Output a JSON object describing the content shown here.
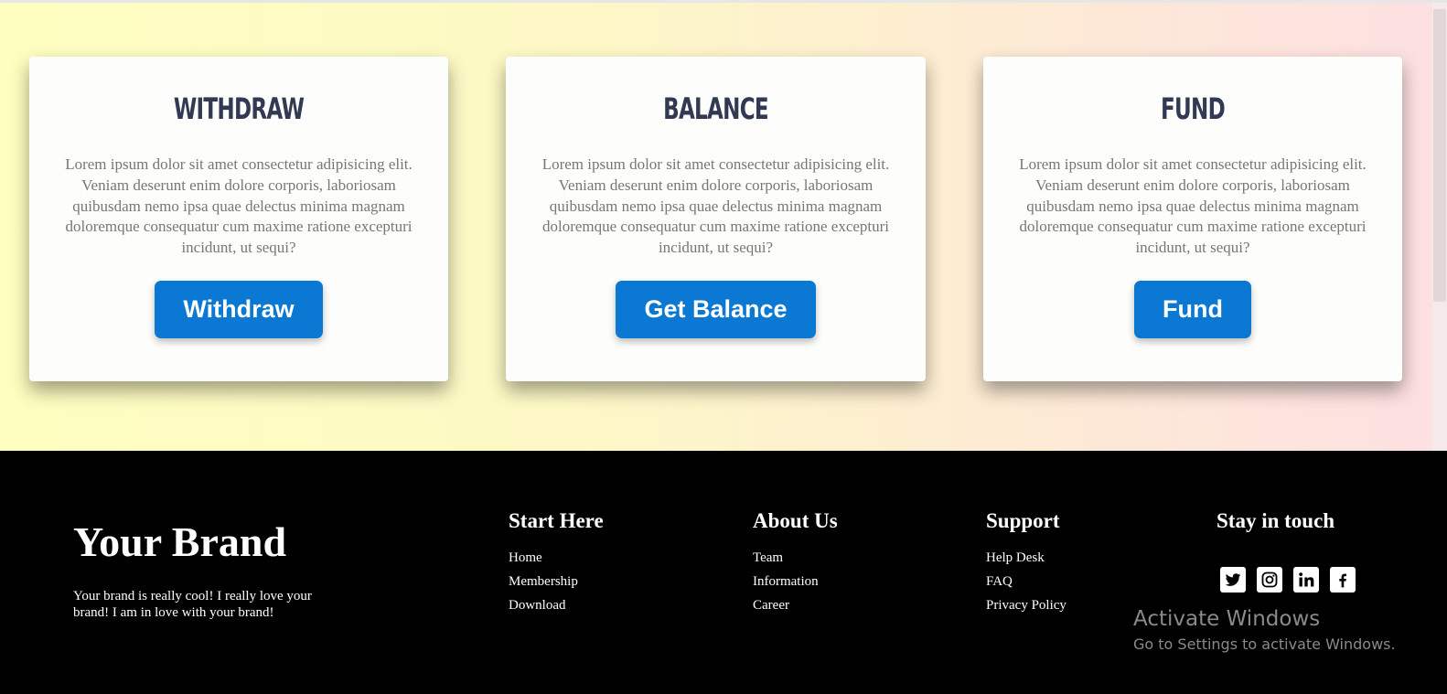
{
  "cards": [
    {
      "title": "WITHDRAW",
      "text": "Lorem ipsum dolor sit amet consectetur adipisicing elit. Veniam deserunt enim dolore corporis, laboriosam quibusdam nemo ipsa quae delectus minima magnam doloremque consequatur cum maxime ratione excepturi incidunt, ut sequi?",
      "button": "Withdraw"
    },
    {
      "title": "BALANCE",
      "text": "Lorem ipsum dolor sit amet consectetur adipisicing elit. Veniam deserunt enim dolore corporis, laboriosam quibusdam nemo ipsa quae delectus minima magnam doloremque consequatur cum maxime ratione excepturi incidunt, ut sequi?",
      "button": "Get Balance"
    },
    {
      "title": "FUND",
      "text": "Lorem ipsum dolor sit amet consectetur adipisicing elit. Veniam deserunt enim dolore corporis, laboriosam quibusdam nemo ipsa quae delectus minima magnam doloremque consequatur cum maxime ratione excepturi incidunt, ut sequi?",
      "button": "Fund"
    }
  ],
  "footer": {
    "brand": "Your Brand",
    "brand_text": "Your brand is really cool! I really love your brand! I am in love with your brand!",
    "columns": [
      {
        "heading": "Start Here",
        "links": [
          "Home",
          "Membership",
          "Download"
        ]
      },
      {
        "heading": "About Us",
        "links": [
          "Team",
          "Information",
          "Career"
        ]
      },
      {
        "heading": "Support",
        "links": [
          "Help Desk",
          "FAQ",
          "Privacy Policy"
        ]
      },
      {
        "heading": "Stay in touch",
        "links": []
      }
    ],
    "social": [
      {
        "icon": "twitter-icon",
        "glyph": "🐦"
      },
      {
        "icon": "instagram-icon",
        "glyph": "◎"
      },
      {
        "icon": "linkedin-icon",
        "glyph": "in"
      },
      {
        "icon": "facebook-icon",
        "glyph": "f"
      }
    ]
  },
  "watermark": {
    "title": "Activate Windows",
    "subtitle": "Go to Settings to activate Windows."
  },
  "colors": {
    "button": "#0b79d4",
    "title": "#313a52",
    "footer_bg": "#000000"
  }
}
